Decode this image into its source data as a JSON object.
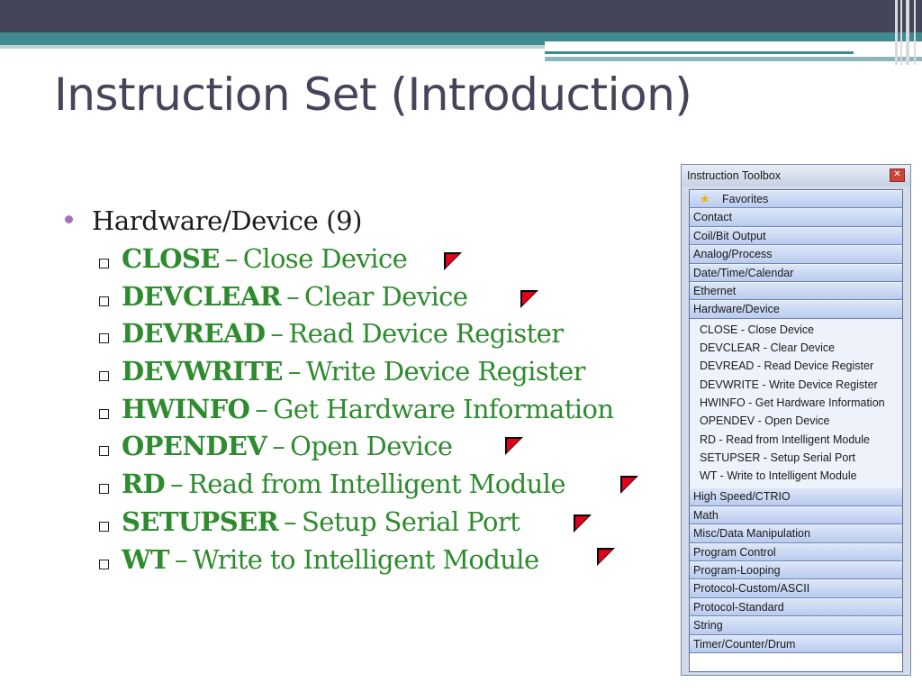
{
  "slide": {
    "title": "Instruction Set (Introduction)",
    "heading": "Hardware/Device (9)",
    "items": [
      {
        "cmd": "CLOSE",
        "sep": "–",
        "desc": "Close Device"
      },
      {
        "cmd": "DEVCLEAR",
        "sep": "–",
        "desc": "Clear Device"
      },
      {
        "cmd": "DEVREAD",
        "sep": "–",
        "desc": "Read Device Register"
      },
      {
        "cmd": "DEVWRITE",
        "sep": "–",
        "desc": "Write Device Register"
      },
      {
        "cmd": "HWINFO",
        "sep": "–",
        "desc": "Get Hardware Information"
      },
      {
        "cmd": "OPENDEV",
        "sep": "–",
        "desc": "Open Device"
      },
      {
        "cmd": "RD",
        "sep": "–",
        "desc": "Read from Intelligent Module"
      },
      {
        "cmd": "SETUPSER",
        "sep": "–",
        "desc": "Setup Serial Port"
      },
      {
        "cmd": "WT",
        "sep": "–",
        "desc": "Write to Intelligent Module"
      }
    ]
  },
  "toolbox": {
    "title": "Instruction Toolbox",
    "close_label": "x",
    "categories_top": [
      "Favorites",
      "Contact",
      "Coil/Bit Output",
      "Analog/Process",
      "Date/Time/Calendar",
      "Ethernet",
      "Hardware/Device"
    ],
    "expanded_items": [
      "CLOSE - Close Device",
      "DEVCLEAR - Clear Device",
      "DEVREAD - Read Device Register",
      "DEVWRITE - Write Device Register",
      "HWINFO - Get Hardware Information",
      "OPENDEV - Open Device",
      "RD - Read from Intelligent Module",
      "SETUPSER - Setup Serial Port",
      "WT - Write to Intelligent Module"
    ],
    "categories_bottom": [
      "High Speed/CTRIO",
      "Math",
      "Misc/Data Manipulation",
      "Program Control",
      "Program-Looping",
      "Protocol-Custom/ASCII",
      "Protocol-Standard",
      "String",
      "Timer/Counter/Drum"
    ]
  },
  "colors": {
    "title": "#44455a",
    "command_green": "#2e8b2e",
    "bullet_purple": "#a76fba",
    "flag_red": "#e0001b"
  },
  "icons": {
    "flag": "red-corner-flag-icon",
    "favorite": "star-icon",
    "bullet_box": "square-bullet-icon"
  }
}
